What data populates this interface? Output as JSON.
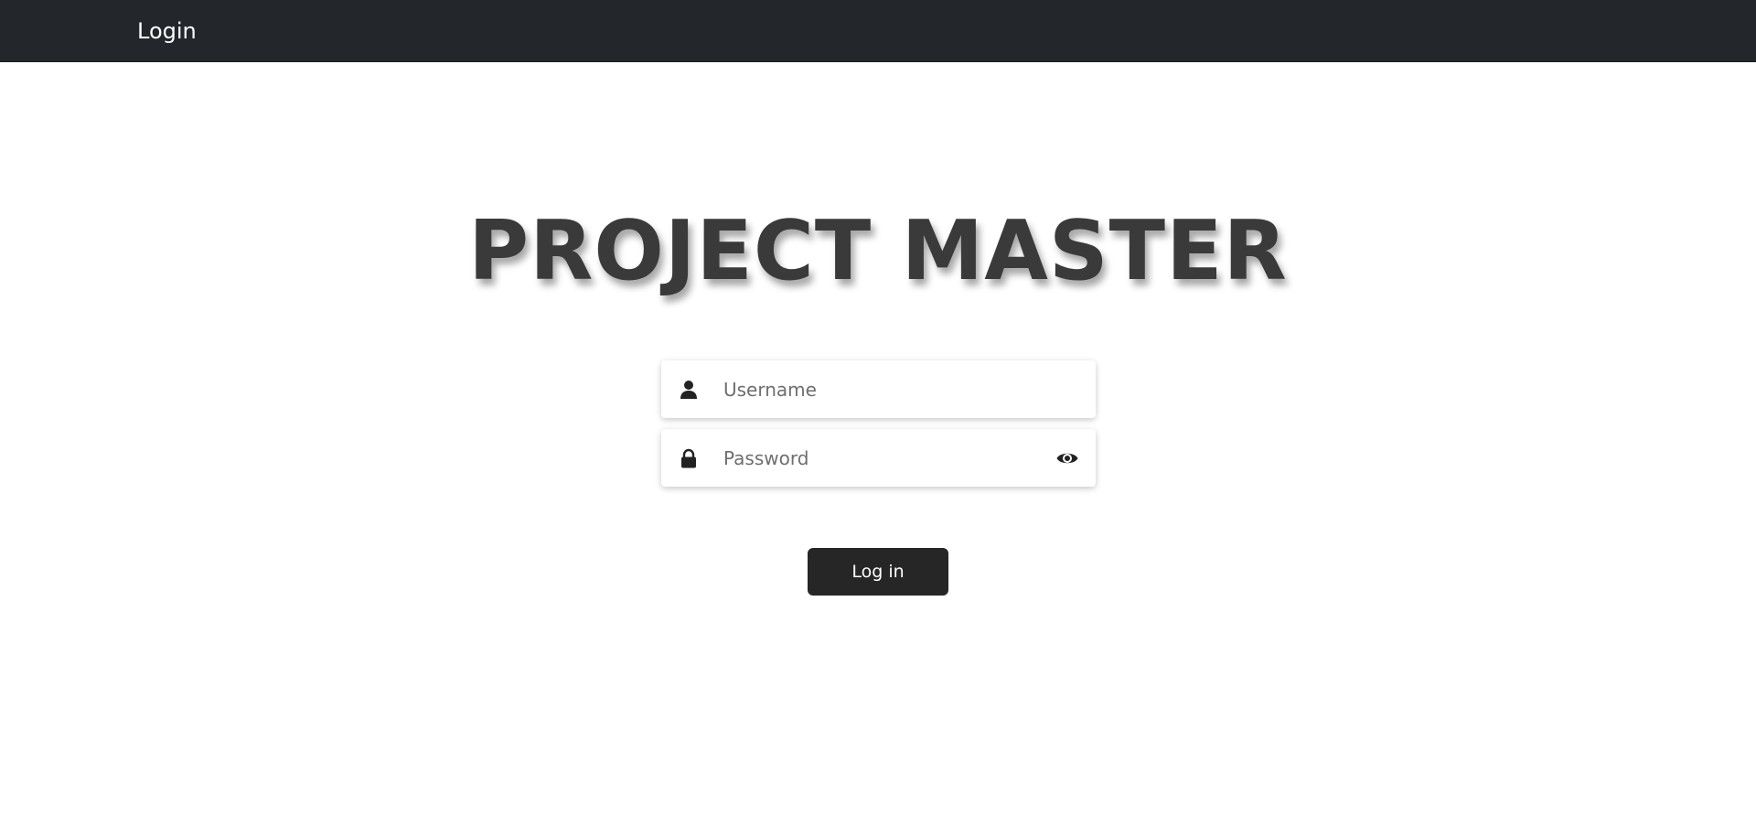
{
  "navbar": {
    "brand": "Login"
  },
  "page": {
    "title": "PROJECT MASTER"
  },
  "form": {
    "username": {
      "icon": "user-icon",
      "placeholder": "Username",
      "value": ""
    },
    "password": {
      "icon": "lock-icon",
      "placeholder": "Password",
      "value": "",
      "toggle_icon": "eye-icon"
    },
    "submit_label": "Log in"
  },
  "colors": {
    "navbar_bg": "#23272b",
    "title_text": "#3a3a3a",
    "button_bg": "#262626"
  }
}
